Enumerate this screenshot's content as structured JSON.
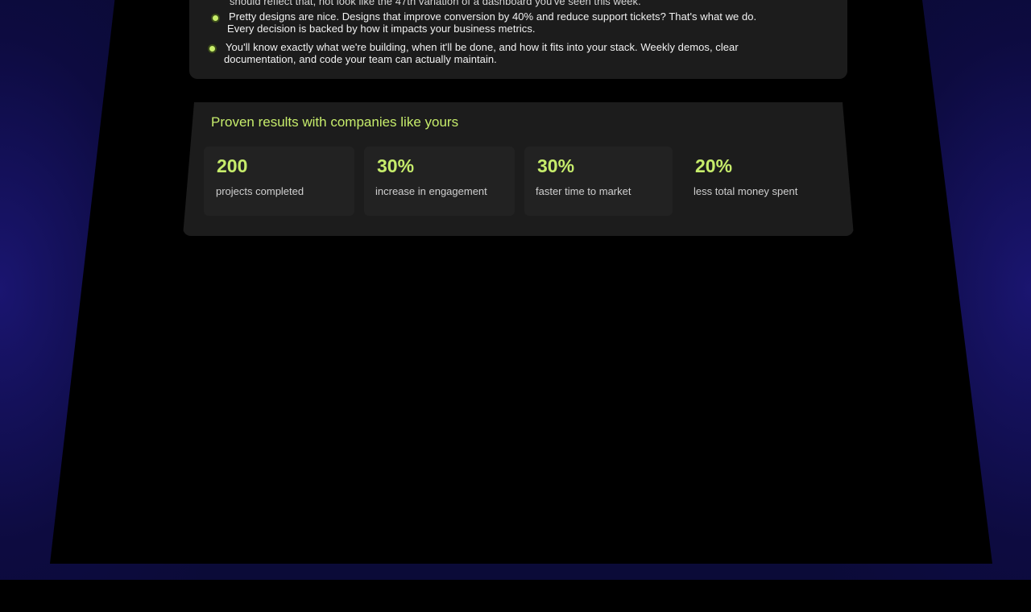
{
  "intro_fragment": "should reflect that, not look like the 47th variation of a dashboard you've seen this week.",
  "bullets": [
    {
      "line1": "Pretty designs are nice. Designs that improve conversion by 40% and reduce support tickets? That's what we do.",
      "line2": "Every decision is backed by how it impacts your business metrics."
    },
    {
      "line1": "You'll know exactly what we're building, when it'll be done, and how it fits into your stack. Weekly demos, clear",
      "line2": "documentation, and code your team can actually maintain."
    }
  ],
  "results": {
    "title": "Proven results with companies like yours",
    "stats": [
      {
        "value": "200",
        "label": "projects completed"
      },
      {
        "value": "30%",
        "label": "increase in engagement"
      },
      {
        "value": "30%",
        "label": "faster time to market"
      },
      {
        "value": "20%",
        "label": "less total money spent"
      }
    ]
  },
  "colors": {
    "accent": "#c6ec6b",
    "panel": "#1c1c1c",
    "background_glow": "#1a1570"
  }
}
